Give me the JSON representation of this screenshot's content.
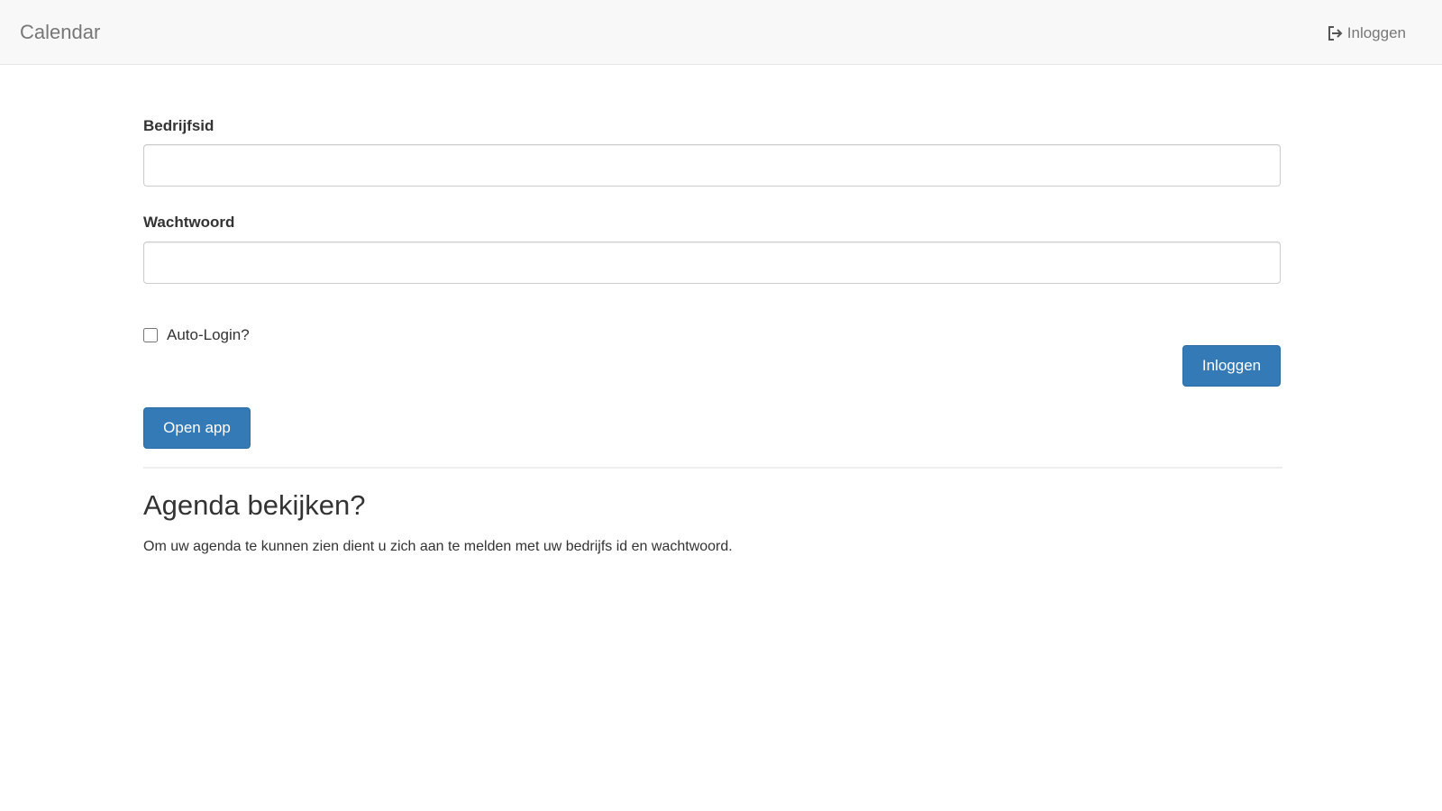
{
  "navbar": {
    "brand": "Calendar",
    "login_label": "Inloggen",
    "login_icon": "sign-in-icon"
  },
  "form": {
    "company_label": "Bedrijfsid",
    "company_value": "",
    "password_label": "Wachtwoord",
    "password_value": "",
    "auto_login_label": "Auto-Login?",
    "auto_login_checked": false,
    "login_button": "Inloggen",
    "open_app_button": "Open app"
  },
  "info": {
    "title": "Agenda bekijken?",
    "text": "Om uw agenda te kunnen zien dient u zich aan te melden met uw bedrijfs id en wachtwoord."
  },
  "colors": {
    "primary": "#337ab7",
    "navbar_bg": "#f8f8f8",
    "nav_text": "#777777"
  }
}
